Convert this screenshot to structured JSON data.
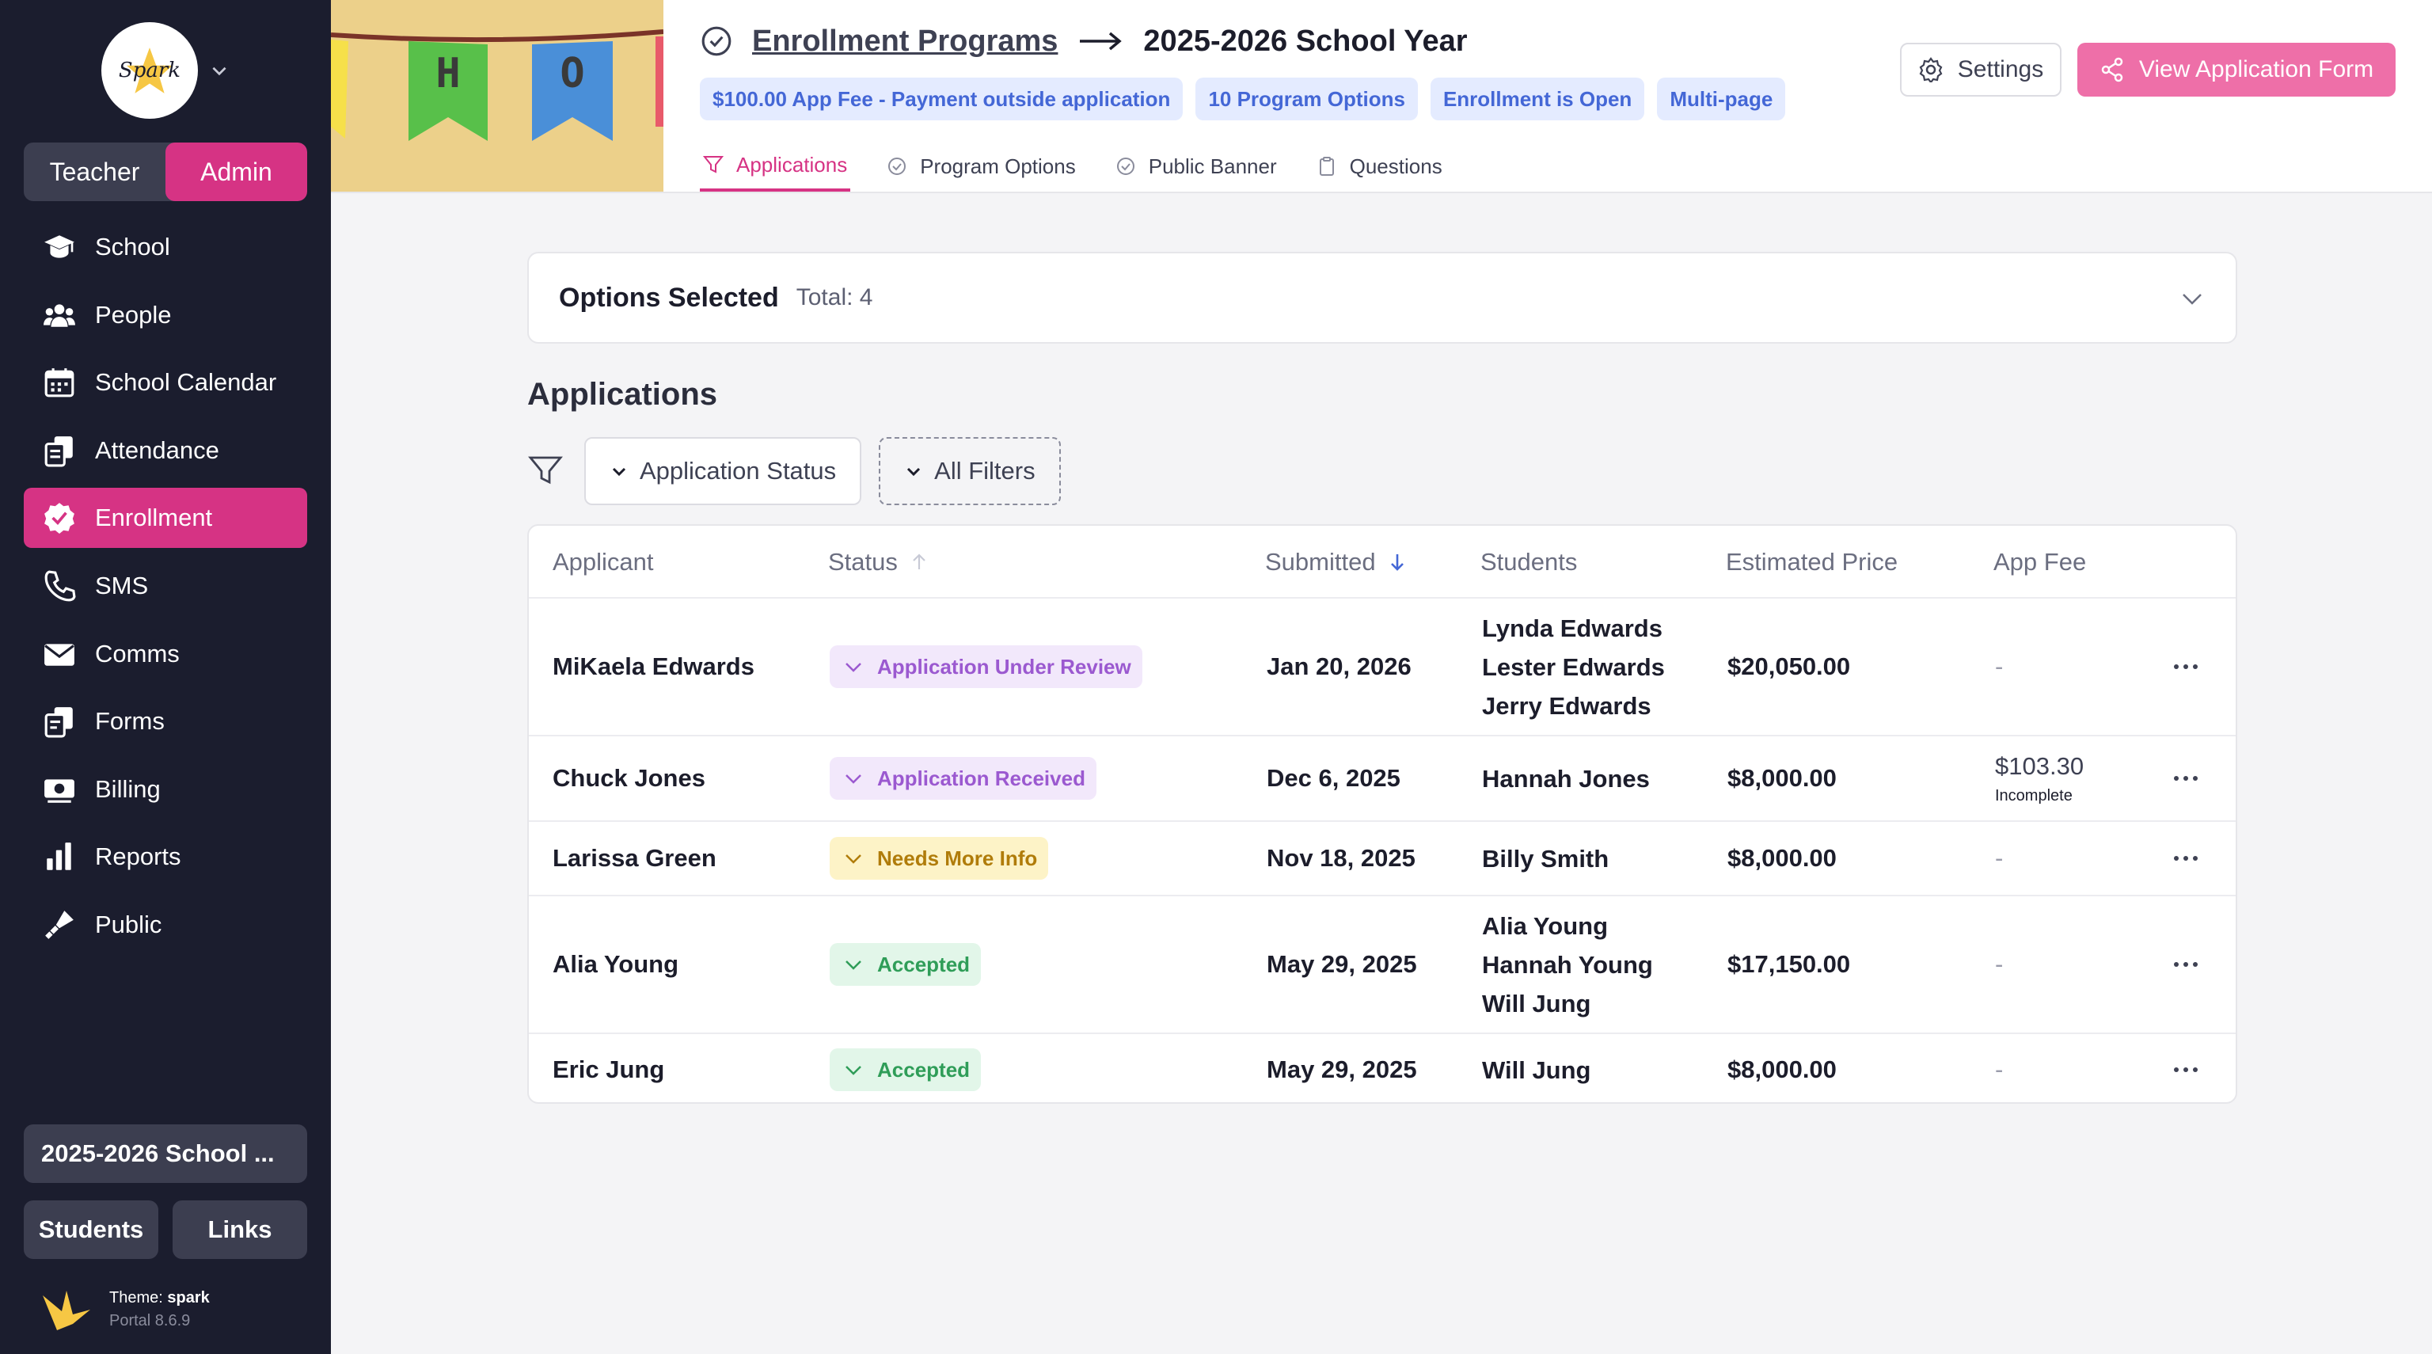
{
  "sidebar": {
    "logo_text": "Spark",
    "roles": [
      "Teacher",
      "Admin"
    ],
    "items": [
      {
        "label": "School",
        "icon": "school-cap-icon"
      },
      {
        "label": "People",
        "icon": "people-icon"
      },
      {
        "label": "School Calendar",
        "icon": "calendar-icon"
      },
      {
        "label": "Attendance",
        "icon": "attendance-icon"
      },
      {
        "label": "Enrollment",
        "icon": "enrollment-check-icon"
      },
      {
        "label": "SMS",
        "icon": "phone-icon"
      },
      {
        "label": "Comms",
        "icon": "mail-icon"
      },
      {
        "label": "Forms",
        "icon": "forms-icon"
      },
      {
        "label": "Billing",
        "icon": "billing-icon"
      },
      {
        "label": "Reports",
        "icon": "bar-chart-icon"
      },
      {
        "label": "Public",
        "icon": "megaphone-icon"
      }
    ],
    "year_button": "2025-2026 School ...",
    "students_button": "Students",
    "links_button": "Links",
    "theme_label": "Theme:",
    "theme_name": "spark",
    "portal_version": "Portal 8.6.9"
  },
  "header": {
    "banner_letters": [
      "H",
      "O"
    ],
    "crumb_link": "Enrollment Programs",
    "crumb_title": "2025-2026 School Year",
    "tags": [
      "$100.00 App Fee - Payment outside application",
      "10 Program Options",
      "Enrollment is Open",
      "Multi-page"
    ],
    "tabs": [
      "Applications",
      "Program Options",
      "Public Banner",
      "Questions"
    ],
    "settings_label": "Settings",
    "view_form_label": "View Application Form"
  },
  "options": {
    "title": "Options Selected",
    "total": "Total: 4"
  },
  "applications": {
    "title": "Applications",
    "filter_status": "Application Status",
    "filter_all": "All Filters",
    "columns": [
      "Applicant",
      "Status",
      "Submitted",
      "Students",
      "Estimated Price",
      "App Fee"
    ],
    "rows": [
      {
        "applicant": "MiKaela Edwards",
        "status": "Application Under Review",
        "submitted": "Jan 20, 2026",
        "students": [
          "Lynda Edwards",
          "Lester Edwards",
          "Jerry Edwards"
        ],
        "price": "$20,050.00",
        "fee": "-",
        "fee_sub": ""
      },
      {
        "applicant": "Chuck Jones",
        "status": "Application Received",
        "submitted": "Dec 6, 2025",
        "students": [
          "Hannah Jones"
        ],
        "price": "$8,000.00",
        "fee": "$103.30",
        "fee_sub": "Incomplete"
      },
      {
        "applicant": "Larissa Green",
        "status": "Needs More Info",
        "submitted": "Nov 18, 2025",
        "students": [
          "Billy Smith"
        ],
        "price": "$8,000.00",
        "fee": "-",
        "fee_sub": ""
      },
      {
        "applicant": "Alia Young",
        "status": "Accepted",
        "submitted": "May 29, 2025",
        "students": [
          "Alia Young",
          "Hannah Young",
          "Will Jung"
        ],
        "price": "$17,150.00",
        "fee": "-",
        "fee_sub": ""
      },
      {
        "applicant": "Eric Jung",
        "status": "Accepted",
        "submitted": "May 29, 2025",
        "students": [
          "Will Jung"
        ],
        "price": "$8,000.00",
        "fee": "-",
        "fee_sub": ""
      }
    ]
  },
  "colors": {
    "accent": "#d63384",
    "sidebar_bg": "#1b1d2e",
    "view_button": "#ee6fa8",
    "tag_bg": "#e4ebff",
    "tag_text": "#4467d6"
  }
}
